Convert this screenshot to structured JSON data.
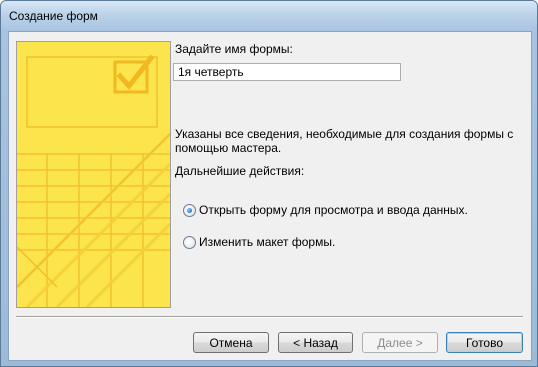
{
  "window": {
    "title": "Создание форм"
  },
  "form": {
    "name_prompt": "Задайте имя формы:",
    "name_value": "1я четверть",
    "info_text_line1": "Указаны все сведения, необходимые для создания формы с",
    "info_text_line2": "помощью мастера.",
    "next_actions_label": "Дальнейшие действия:",
    "options": [
      {
        "label": "Открыть форму для просмотра и ввода данных.",
        "selected": true
      },
      {
        "label": "Изменить макет формы.",
        "selected": false
      }
    ]
  },
  "buttons": {
    "cancel": "Отмена",
    "back": "< Назад",
    "next": "Далее >",
    "finish": "Готово"
  },
  "icons": {
    "wizard_art": "form-wizard-illustration",
    "check": "check-icon"
  },
  "colors": {
    "panel": "#fce44c",
    "panel_lines": "#f7c52a",
    "titlebar": "#b9d0e8"
  }
}
